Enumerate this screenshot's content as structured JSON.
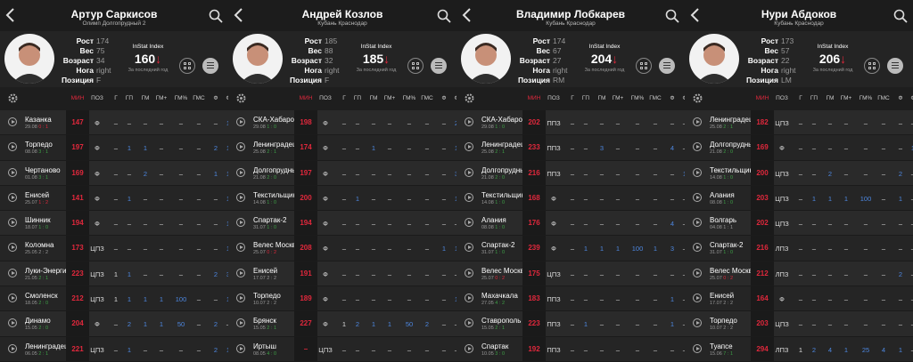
{
  "columns": [
    "ПОЗ",
    "Г",
    "ГП",
    "ГМ",
    "ГМ+",
    "ГМ%",
    "ГМС",
    "Ф",
    "Ф"
  ],
  "min_header": "МИН",
  "players": [
    {
      "name": "Артур Саркисов",
      "club": "Олимп Долгопрудный 2",
      "stats": [
        [
          "Рост",
          "174"
        ],
        [
          "Вес",
          "75"
        ],
        [
          "Возраст",
          "34"
        ],
        [
          "Нога",
          "right"
        ],
        [
          "Позиция",
          "F"
        ]
      ],
      "index_label": "InStat Index",
      "index_value": "160",
      "index_sub": "За последний год",
      "matches": [
        {
          "team": "Казанка",
          "date": "29.08",
          "score": "0 : 1",
          "min": "147",
          "pos": "Ф",
          "v": [
            "–",
            "–",
            "–",
            "–",
            "–",
            "–",
            "–",
            "1"
          ]
        },
        {
          "team": "Торпедо",
          "date": "08.08",
          "score": "3 : 1",
          "min": "197",
          "pos": "Ф",
          "v": [
            "–",
            "1",
            "1",
            "–",
            "–",
            "–",
            "2",
            "1"
          ]
        },
        {
          "team": "Чертаново",
          "date": "01.08",
          "score": "3 : 1",
          "min": "169",
          "pos": "Ф",
          "v": [
            "–",
            "–",
            "2",
            "–",
            "–",
            "–",
            "1",
            "1"
          ]
        },
        {
          "team": "Енисей",
          "date": "25.07",
          "score": "1 : 2",
          "min": "141",
          "pos": "Ф",
          "v": [
            "–",
            "1",
            "–",
            "–",
            "–",
            "–",
            "–",
            "1"
          ]
        },
        {
          "team": "Шинник",
          "date": "18.07",
          "score": "1 : 0",
          "min": "194",
          "pos": "Ф",
          "v": [
            "–",
            "–",
            "–",
            "–",
            "–",
            "–",
            "–",
            "1"
          ]
        },
        {
          "team": "Коломна",
          "date": "25.05",
          "score": "2 : 2",
          "min": "173",
          "pos": "ЦПЗ",
          "v": [
            "–",
            "–",
            "–",
            "–",
            "–",
            "–",
            "–",
            "1"
          ]
        },
        {
          "team": "Луки-Энергия",
          "date": "21.05",
          "score": "2 : 1",
          "min": "223",
          "pos": "ЦПЗ",
          "v": [
            "1",
            "1",
            "–",
            "–",
            "–",
            "–",
            "2",
            "3"
          ]
        },
        {
          "team": "Смоленск",
          "date": "18.05",
          "score": "2 : 0",
          "min": "212",
          "pos": "ЦПЗ",
          "v": [
            "1",
            "1",
            "1",
            "1",
            "100",
            "–",
            "–",
            "1"
          ]
        },
        {
          "team": "Динамо",
          "date": "15.05",
          "score": "2 : 0",
          "min": "204",
          "pos": "Ф",
          "v": [
            "–",
            "2",
            "1",
            "1",
            "50",
            "–",
            "2",
            "–"
          ]
        },
        {
          "team": "Ленинградец",
          "date": "06.05",
          "score": "2 : 1",
          "min": "221",
          "pos": "ЦПЗ",
          "v": [
            "–",
            "1",
            "–",
            "–",
            "–",
            "–",
            "2",
            "1"
          ]
        }
      ]
    },
    {
      "name": "Андрей Козлов",
      "club": "Кубань Краснодар",
      "stats": [
        [
          "Рост",
          "185"
        ],
        [
          "Вес",
          "88"
        ],
        [
          "Возраст",
          "32"
        ],
        [
          "Нога",
          "right"
        ],
        [
          "Позиция",
          "F"
        ]
      ],
      "index_label": "InStat Index",
      "index_value": "185",
      "index_sub": "За последний год",
      "matches": [
        {
          "team": "СКА-Хабаровск",
          "date": "29.08",
          "score": "1 : 0",
          "min": "198",
          "pos": "Ф",
          "v": [
            "–",
            "–",
            "–",
            "–",
            "–",
            "–",
            "–",
            "2"
          ]
        },
        {
          "team": "Ленинградец",
          "date": "25.08",
          "score": "2 : 1",
          "min": "174",
          "pos": "Ф",
          "v": [
            "–",
            "–",
            "1",
            "–",
            "–",
            "–",
            "–",
            "1"
          ]
        },
        {
          "team": "Долгопрудный",
          "date": "21.08",
          "score": "2 : 0",
          "min": "197",
          "pos": "Ф",
          "v": [
            "–",
            "–",
            "–",
            "–",
            "–",
            "–",
            "–",
            "3"
          ]
        },
        {
          "team": "Текстильщик",
          "date": "14.08",
          "score": "1 : 0",
          "min": "200",
          "pos": "Ф",
          "v": [
            "–",
            "1",
            "–",
            "–",
            "–",
            "–",
            "–",
            "1"
          ]
        },
        {
          "team": "Спартак-2",
          "date": "31.07",
          "score": "1 : 0",
          "min": "194",
          "pos": "Ф",
          "v": [
            "–",
            "–",
            "–",
            "–",
            "–",
            "–",
            "–",
            "–"
          ]
        },
        {
          "team": "Велес Москва",
          "date": "25.07",
          "score": "0 : 2",
          "min": "208",
          "pos": "Ф",
          "v": [
            "–",
            "–",
            "–",
            "–",
            "–",
            "–",
            "1",
            "1"
          ]
        },
        {
          "team": "Енисей",
          "date": "17.07",
          "score": "2 : 2",
          "min": "191",
          "pos": "Ф",
          "v": [
            "–",
            "–",
            "–",
            "–",
            "–",
            "–",
            "–",
            "–"
          ]
        },
        {
          "team": "Торпедо",
          "date": "10.07",
          "score": "2 : 2",
          "min": "189",
          "pos": "Ф",
          "v": [
            "–",
            "–",
            "–",
            "–",
            "–",
            "–",
            "–",
            "1"
          ]
        },
        {
          "team": "Брянск",
          "date": "15.05",
          "score": "2 : 1",
          "min": "227",
          "pos": "Ф",
          "v": [
            "1",
            "2",
            "1",
            "1",
            "50",
            "2",
            "–",
            "–"
          ]
        },
        {
          "team": "Иртыш",
          "date": "08.05",
          "score": "4 : 0",
          "min": "–",
          "pos": "ЦПЗ",
          "v": [
            "–",
            "–",
            "–",
            "–",
            "–",
            "–",
            "–",
            "–"
          ]
        }
      ]
    },
    {
      "name": "Владимир Лобкарев",
      "club": "Кубань Краснодар",
      "stats": [
        [
          "Рост",
          "174"
        ],
        [
          "Вес",
          "67"
        ],
        [
          "Возраст",
          "27"
        ],
        [
          "Нога",
          "right"
        ],
        [
          "Позиция",
          "RM"
        ]
      ],
      "index_label": "InStat Index",
      "index_value": "204",
      "index_sub": "За последний год",
      "matches": [
        {
          "team": "СКА-Хабаровск",
          "date": "29.08",
          "score": "1 : 0",
          "min": "202",
          "pos": "ППЗ",
          "v": [
            "–",
            "–",
            "–",
            "–",
            "–",
            "–",
            "–",
            "–"
          ]
        },
        {
          "team": "Ленинградец",
          "date": "25.08",
          "score": "2 : 1",
          "min": "233",
          "pos": "ППЗ",
          "v": [
            "–",
            "–",
            "3",
            "–",
            "–",
            "–",
            "4",
            "–"
          ]
        },
        {
          "team": "Долгопрудный",
          "date": "21.08",
          "score": "2 : 0",
          "min": "216",
          "pos": "ППЗ",
          "v": [
            "–",
            "–",
            "–",
            "–",
            "–",
            "–",
            "–",
            "1"
          ]
        },
        {
          "team": "Текстильщик",
          "date": "14.08",
          "score": "1 : 0",
          "min": "168",
          "pos": "Ф",
          "v": [
            "–",
            "–",
            "–",
            "–",
            "–",
            "–",
            "–",
            "–"
          ]
        },
        {
          "team": "Алания",
          "date": "08.08",
          "score": "1 : 0",
          "min": "176",
          "pos": "Ф",
          "v": [
            "–",
            "–",
            "–",
            "–",
            "–",
            "–",
            "4",
            "–"
          ]
        },
        {
          "team": "Спартак-2",
          "date": "31.07",
          "score": "1 : 0",
          "min": "239",
          "pos": "Ф",
          "v": [
            "–",
            "1",
            "1",
            "1",
            "100",
            "1",
            "3",
            "–"
          ]
        },
        {
          "team": "Велес Москва",
          "date": "25.07",
          "score": "0 : 2",
          "min": "175",
          "pos": "ЦПЗ",
          "v": [
            "–",
            "–",
            "–",
            "–",
            "–",
            "–",
            "–",
            "–"
          ]
        },
        {
          "team": "Махачкала",
          "date": "27.05",
          "score": "4 : 2",
          "min": "183",
          "pos": "ППЗ",
          "v": [
            "–",
            "–",
            "–",
            "–",
            "–",
            "–",
            "1",
            "–"
          ]
        },
        {
          "team": "Ставрополь",
          "date": "15.05",
          "score": "2 : 1",
          "min": "223",
          "pos": "ППЗ",
          "v": [
            "–",
            "1",
            "–",
            "–",
            "–",
            "–",
            "1",
            "–"
          ]
        },
        {
          "team": "Спартак",
          "date": "10.05",
          "score": "3 : 0",
          "min": "192",
          "pos": "ППЗ",
          "v": [
            "–",
            "–",
            "–",
            "–",
            "–",
            "–",
            "–",
            "–"
          ]
        }
      ]
    },
    {
      "name": "Нури Абдоков",
      "club": "Кубань Краснодар",
      "stats": [
        [
          "Рост",
          "173"
        ],
        [
          "Вес",
          "57"
        ],
        [
          "Возраст",
          "22"
        ],
        [
          "Нога",
          "right"
        ],
        [
          "Позиция",
          "LM"
        ]
      ],
      "index_label": "InStat Index",
      "index_value": "206",
      "index_sub": "За последний год",
      "matches": [
        {
          "team": "Ленинградец",
          "date": "25.08",
          "score": "2 : 1",
          "min": "182",
          "pos": "ЦПЗ",
          "v": [
            "–",
            "–",
            "–",
            "–",
            "–",
            "–",
            "–",
            "–"
          ]
        },
        {
          "team": "Долгопрудный",
          "date": "21.08",
          "score": "2 : 0",
          "min": "169",
          "pos": "Ф",
          "v": [
            "–",
            "–",
            "–",
            "–",
            "–",
            "–",
            "–",
            "1"
          ]
        },
        {
          "team": "Текстильщик",
          "date": "14.08",
          "score": "1 : 0",
          "min": "200",
          "pos": "ЦПЗ",
          "v": [
            "–",
            "–",
            "2",
            "–",
            "–",
            "–",
            "2",
            "–"
          ]
        },
        {
          "team": "Алания",
          "date": "08.08",
          "score": "1 : 0",
          "min": "203",
          "pos": "ЦПЗ",
          "v": [
            "–",
            "1",
            "1",
            "1",
            "100",
            "–",
            "1",
            "–"
          ]
        },
        {
          "team": "Волгарь",
          "date": "04.08",
          "score": "1 : 1",
          "min": "202",
          "pos": "ЦПЗ",
          "v": [
            "–",
            "–",
            "–",
            "–",
            "–",
            "–",
            "–",
            "–"
          ]
        },
        {
          "team": "Спартак-2",
          "date": "31.07",
          "score": "1 : 0",
          "min": "216",
          "pos": "ЛПЗ",
          "v": [
            "–",
            "–",
            "–",
            "–",
            "–",
            "–",
            "–",
            "–"
          ]
        },
        {
          "team": "Велес Москва",
          "date": "25.07",
          "score": "0 : 2",
          "min": "212",
          "pos": "ЛПЗ",
          "v": [
            "–",
            "–",
            "–",
            "–",
            "–",
            "–",
            "2",
            "–"
          ]
        },
        {
          "team": "Енисей",
          "date": "17.07",
          "score": "2 : 2",
          "min": "164",
          "pos": "Ф",
          "v": [
            "–",
            "–",
            "–",
            "–",
            "–",
            "–",
            "–",
            "–"
          ]
        },
        {
          "team": "Торпедо",
          "date": "10.07",
          "score": "2 : 2",
          "min": "203",
          "pos": "ЦПЗ",
          "v": [
            "–",
            "–",
            "–",
            "–",
            "–",
            "–",
            "–",
            "–"
          ]
        },
        {
          "team": "Туапсе",
          "date": "15.06",
          "score": "7 : 1",
          "min": "294",
          "pos": "ЛПЗ",
          "v": [
            "1",
            "2",
            "4",
            "1",
            "25",
            "4",
            "1",
            "–"
          ]
        }
      ]
    }
  ],
  "colors": {
    "accent_red": "#e0283c",
    "win_green": "#3ea046",
    "link_blue": "#4d87e0"
  }
}
